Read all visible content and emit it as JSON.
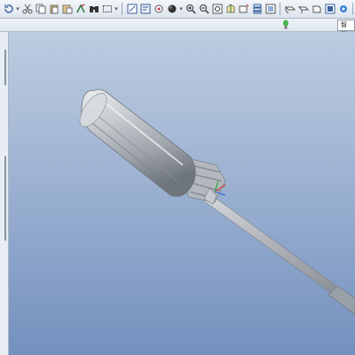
{
  "toolbar": {
    "icons": [
      "rotate-view-icon",
      "caret-down",
      "scissors-icon",
      "copy-icon",
      "paste-icon",
      "paste-special-icon",
      "regenerate-icon",
      "find-icon",
      "select-box-icon",
      "sep",
      "refit-icon",
      "named-view-icon",
      "view-manager-icon",
      "shading-sphere-icon",
      "caret-down",
      "zoom-in-icon",
      "zoom-out-icon",
      "zoom-window-icon",
      "reorient-icon",
      "saved-views-icon",
      "layers-icon",
      "appearance-icon",
      "sep",
      "datum-plane-icon",
      "datum-axis-icon",
      "datum-point-icon",
      "coordinate-system-icon",
      "spin-center-icon",
      "sep",
      "more-icon"
    ]
  },
  "subbar": {
    "smart_label": "智能"
  },
  "viewport": {
    "model": "screwdriver"
  },
  "colors": {
    "background_top": "#bccbe0",
    "background_bottom": "#7390bd",
    "handle": "#c9cdd2",
    "shaft": "#b4b8bd"
  }
}
